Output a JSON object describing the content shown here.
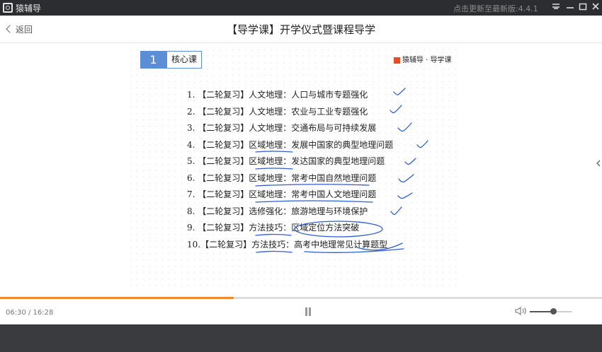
{
  "titlebar": {
    "app_name": "猿辅导",
    "update_notice": "点击更新至最新版:4.4.1",
    "icons": [
      "menu-icon",
      "minimize-icon",
      "maximize-icon",
      "close-icon"
    ]
  },
  "header": {
    "back_label": "返回",
    "title": "【导学课】开学仪式暨课程导学"
  },
  "slide": {
    "badge_number": "1",
    "badge_label": "核心课",
    "brand": "猿辅导 · 导学课",
    "items": [
      "1. 【二轮复习】人文地理：人口与城市专题强化",
      "2. 【二轮复习】人文地理：农业与工业专题强化",
      "3. 【二轮复习】人文地理：交通布局与可持续发展",
      "4. 【二轮复习】区域地理：发展中国家的典型地理问题",
      "5. 【二轮复习】区域地理：发达国家的典型地理问题",
      "6. 【二轮复习】区域地理：常考中国自然地理问题",
      "7. 【二轮复习】区域地理：常考中国人文地理问题",
      "8. 【二轮复习】选修强化：旅游地理与环境保护",
      "9. 【二轮复习】方法技巧：区域定位方法突破",
      "10.【二轮复习】方法技巧：高考中地理常见计算题型"
    ],
    "annotation_color": "#2f5fd0"
  },
  "player": {
    "time_text": "06:30 / 16:28",
    "progress": 0.388,
    "volume": 0.55,
    "accent_color": "#f08a2c"
  }
}
